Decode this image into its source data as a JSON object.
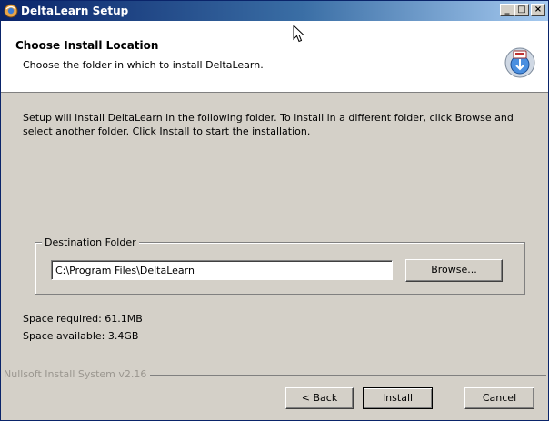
{
  "window": {
    "title": "DeltaLearn Setup",
    "controls": {
      "minimize": "_",
      "maximize": "□",
      "close": "×"
    }
  },
  "header": {
    "title": "Choose Install Location",
    "subtitle": "Choose the folder in which to install DeltaLearn."
  },
  "body": {
    "intro": "Setup will install DeltaLearn in the following folder. To install in a different folder, click Browse and select another folder. Click Install to start the installation."
  },
  "destination": {
    "group_label": "Destination Folder",
    "path_value": "C:\\Program Files\\DeltaLearn",
    "browse_label": "Browse..."
  },
  "space": {
    "required": "Space required: 61.1MB",
    "available": "Space available: 3.4GB"
  },
  "footer": {
    "brand": "Nullsoft Install System v2.16",
    "back_label": "< Back",
    "install_label": "Install",
    "cancel_label": "Cancel"
  },
  "colors": {
    "titlebar_start": "#0a246a",
    "titlebar_end": "#a6caf0",
    "dialog_bg": "#d4d0c8"
  },
  "icons": {
    "app": "installer-icon",
    "header": "install-disk-icon"
  }
}
